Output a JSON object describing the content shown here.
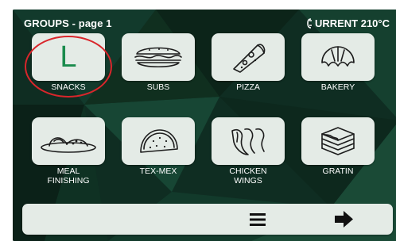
{
  "header": {
    "title": "GROUPS - page 1",
    "status": "CURRENT 210°C"
  },
  "tiles": [
    {
      "label": "SNACKS",
      "icon": "letter-l-icon",
      "icon_text": "L",
      "highlighted": true
    },
    {
      "label": "SUBS",
      "icon": "sandwich-icon"
    },
    {
      "label": "PIZZA",
      "icon": "pizza-slice-icon"
    },
    {
      "label": "BAKERY",
      "icon": "croissant-icon"
    },
    {
      "label": "MEAL FINISHING",
      "label_lines": [
        "MEAL",
        "FINISHING"
      ],
      "icon": "plated-meal-icon"
    },
    {
      "label": "TEX-MEX",
      "icon": "taco-icon"
    },
    {
      "label": "CHICKEN WINGS",
      "label_lines": [
        "CHICKEN",
        "WINGS"
      ],
      "icon": "chicken-wings-icon"
    },
    {
      "label": "GRATIN",
      "icon": "lasagna-icon"
    }
  ],
  "bottom_bar": {
    "menu_icon": "hamburger-menu-icon",
    "next_icon": "right-arrow-icon"
  },
  "colors": {
    "background": "#0e2a20",
    "tile": "#e4ebe6",
    "accent_letter": "#1a8b4d",
    "highlight": "#d9262b"
  }
}
